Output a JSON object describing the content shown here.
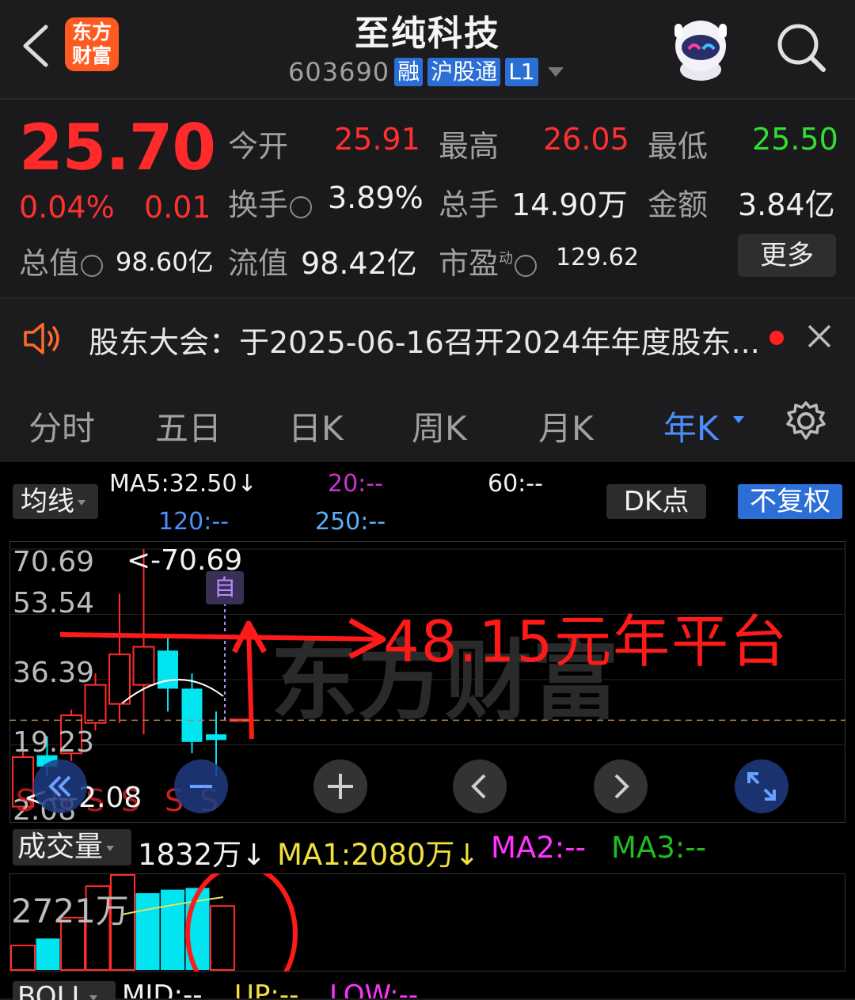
{
  "header": {
    "back_icon": "chevron-left-icon",
    "logo_line1": "东方",
    "logo_line2": "财富",
    "stock_name": "至纯科技",
    "stock_code": "603690",
    "tags": [
      "融",
      "沪股通",
      "L1"
    ],
    "search_icon": "search-icon"
  },
  "quote": {
    "price": "25.70",
    "change_pct": "0.04%",
    "change_amt": "0.01",
    "rows": [
      [
        {
          "label": "今开",
          "value": "25.91",
          "color": "red"
        },
        {
          "label": "最高",
          "value": "26.05",
          "color": "red"
        },
        {
          "label": "最低",
          "value": "25.50",
          "color": "green"
        }
      ],
      [
        {
          "label": "换手",
          "value": "3.89%",
          "color": "white"
        },
        {
          "label": "总手",
          "value": "14.90万",
          "color": "white"
        },
        {
          "label": "金额",
          "value": "3.84亿",
          "color": "white"
        }
      ]
    ],
    "total_value_label": "总值",
    "total_value": "98.60亿",
    "float_value_label": "流值",
    "float_value": "98.42亿",
    "pe_label": "市盈",
    "pe_sup": "动",
    "pe_value": "129.62",
    "more_label": "更多"
  },
  "notice": {
    "text": "股东大会：于2025-06-16召开2024年年度股东..."
  },
  "tabs": [
    "分时",
    "五日",
    "日K",
    "周K",
    "月K",
    "年K"
  ],
  "active_tab": "年K",
  "chart": {
    "ma_button": "均线",
    "ma5": "MA5:32.50↓",
    "ma20": "20:--",
    "ma60": "60:--",
    "ma120": "120:--",
    "ma250": "250:--",
    "dk_button": "DK点",
    "adjust_button": "不复权",
    "y_labels": [
      "70.69",
      "53.54",
      "36.39",
      "19.23",
      "2.08"
    ],
    "high_annotation": "<-70.69",
    "low_annotation": "<---2.08",
    "platform_annotation": "48.15元年平台",
    "self_mark": "自",
    "ss_marks": [
      "S S S S",
      "S S"
    ],
    "watermark": "东方财富",
    "current_price_line": 25.7,
    "colors": {
      "up": "#ff2a2a",
      "down": "#00e5f0",
      "annotation": "#ff1a1a"
    }
  },
  "volume": {
    "label": "成交量",
    "current": "1832万↓",
    "ma1": "MA1:2080万↓",
    "ma2": "MA2:--",
    "ma3": "MA3:--",
    "max_label": "2721万"
  },
  "boll": {
    "label": "BOLL",
    "mid": "MID:--",
    "up": "UP:--",
    "low": "LOW:--"
  },
  "chart_data": {
    "type": "candlestick",
    "ylim": [
      2.08,
      70.69
    ],
    "candles": [
      {
        "o": 3.0,
        "c": 16.0,
        "h": 18.0,
        "l": 2.08,
        "dir": "up"
      },
      {
        "o": 13.5,
        "c": 16.5,
        "h": 21.5,
        "l": 11.0,
        "dir": "down"
      },
      {
        "o": 17.0,
        "c": 27.0,
        "h": 28.5,
        "l": 15.0,
        "dir": "up"
      },
      {
        "o": 25.0,
        "c": 35.0,
        "h": 38.0,
        "l": 23.0,
        "dir": "up"
      },
      {
        "o": 30.0,
        "c": 43.0,
        "h": 59.0,
        "l": 25.0,
        "dir": "up"
      },
      {
        "o": 35.0,
        "c": 45.0,
        "h": 70.69,
        "l": 22.0,
        "dir": "up"
      },
      {
        "o": 44.0,
        "c": 34.0,
        "h": 48.0,
        "l": 28.0,
        "dir": "down"
      },
      {
        "o": 34.0,
        "c": 20.0,
        "h": 38.0,
        "l": 17.0,
        "dir": "down"
      },
      {
        "o": 22.0,
        "c": 20.5,
        "h": 28.0,
        "l": 11.0,
        "dir": "down"
      },
      {
        "o": 25.91,
        "c": 25.7,
        "h": 26.05,
        "l": 25.5,
        "dir": "up"
      }
    ],
    "volume_bars": [
      {
        "v": 700,
        "dir": "up"
      },
      {
        "v": 900,
        "dir": "down"
      },
      {
        "v": 1500,
        "dir": "up"
      },
      {
        "v": 2400,
        "dir": "up"
      },
      {
        "v": 2721,
        "dir": "up"
      },
      {
        "v": 2200,
        "dir": "down"
      },
      {
        "v": 2300,
        "dir": "down"
      },
      {
        "v": 2350,
        "dir": "down"
      },
      {
        "v": 1832,
        "dir": "up"
      }
    ],
    "volume_max": 2721
  }
}
